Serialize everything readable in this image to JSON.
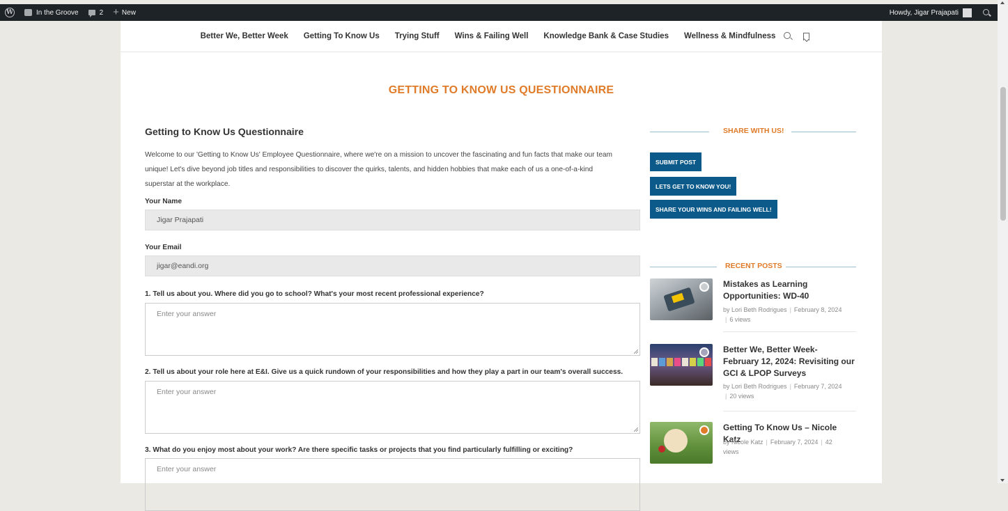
{
  "admin_bar": {
    "site_name": "In the Groove",
    "comments_count": "2",
    "new_label": "New",
    "howdy": "Howdy, Jigar Prajapati"
  },
  "nav": {
    "items": [
      "Better We, Better Week",
      "Getting To Know Us",
      "Trying Stuff",
      "Wins & Failing Well",
      "Knowledge Bank & Case Studies",
      "Wellness & Mindfulness"
    ]
  },
  "page_title": "GETTING TO KNOW US QUESTIONNAIRE",
  "form": {
    "heading": "Getting to Know Us Questionnaire",
    "intro_lines": [
      "Welcome to our 'Getting to Know Us' Employee Questionnaire, where we're on a mission to uncover the fascinating and fun facts that make our team",
      "unique! Let's dive beyond job titles and responsibilities to discover the quirks, talents, and hidden hobbies that make each of us a one-of-a-kind",
      "superstar at the workplace."
    ],
    "name_label": "Your Name",
    "name_value": "Jigar Prajapati",
    "email_label": "Your Email",
    "email_value": "jigar@eandi.org",
    "placeholder": "Enter your answer",
    "questions": [
      "1. Tell us about you. Where did you go to school? What's your most recent professional experience?",
      "2. Tell us about your role here at E&I. Give us a quick rundown of your responsibilities and how they play a part in our team's overall success.",
      "3. What do you enjoy most about your work? Are there specific tasks or projects that you find particularly fulfilling or exciting?"
    ]
  },
  "sidebar": {
    "share_title": "SHARE WITH US!",
    "buttons": [
      "SUBMIT POST",
      "LETS GET TO KNOW YOU!",
      "SHARE YOUR WINS AND FAILING WELL!"
    ],
    "recent_title": "RECENT POSTS",
    "posts": [
      {
        "title": "Mistakes as Learning Opportunities: WD-40",
        "author": "by Lori Beth Rodrigues",
        "date": "February 8, 2024",
        "views": "6 views"
      },
      {
        "title": "Better We, Better Week- February 12, 2024: Revisiting our GCI & LPOP Surveys",
        "author": "by Lori Beth Rodrigues",
        "date": "February 7, 2024",
        "views": "20 views"
      },
      {
        "title": "Getting To Know Us – Nicole Katz",
        "author": "by Nicole Katz",
        "date": "February 7, 2024",
        "views": "42",
        "views_suffix": "views"
      }
    ]
  },
  "colors": {
    "accent_orange": "#e07b2a",
    "button_blue": "#0b5a8a",
    "admin_bar": "#1d2327"
  }
}
